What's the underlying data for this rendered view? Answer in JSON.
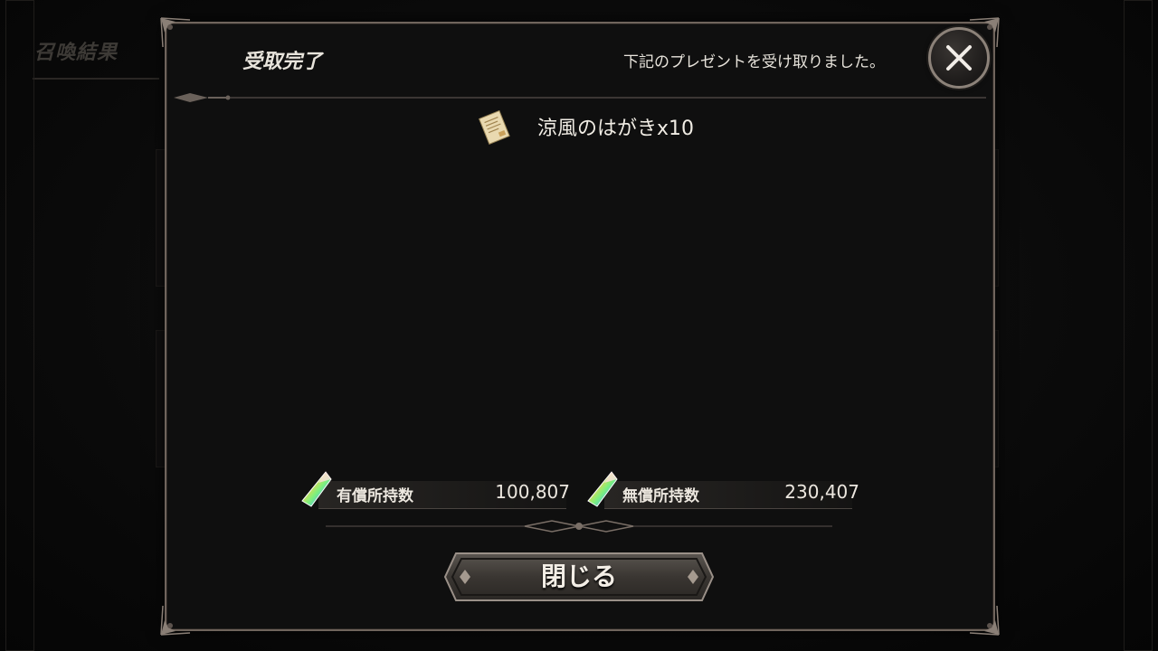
{
  "background": {
    "screen_title": "召喚結果"
  },
  "dialog": {
    "title": "受取完了",
    "message": "下記のプレゼントを受け取りました。",
    "reward": {
      "name": "涼風のはがきx10",
      "icon": "postcard-icon"
    },
    "currencies": [
      {
        "label": "有償所持数",
        "value": "100,807",
        "icon": "crystal-icon"
      },
      {
        "label": "無償所持数",
        "value": "230,407",
        "icon": "crystal-icon"
      }
    ],
    "close_button_label": "閉じる",
    "close_icon": "close-x-icon"
  },
  "colors": {
    "frame": "#6f645c",
    "panel": "#0f0f0f",
    "text": "#e8e4dc"
  }
}
